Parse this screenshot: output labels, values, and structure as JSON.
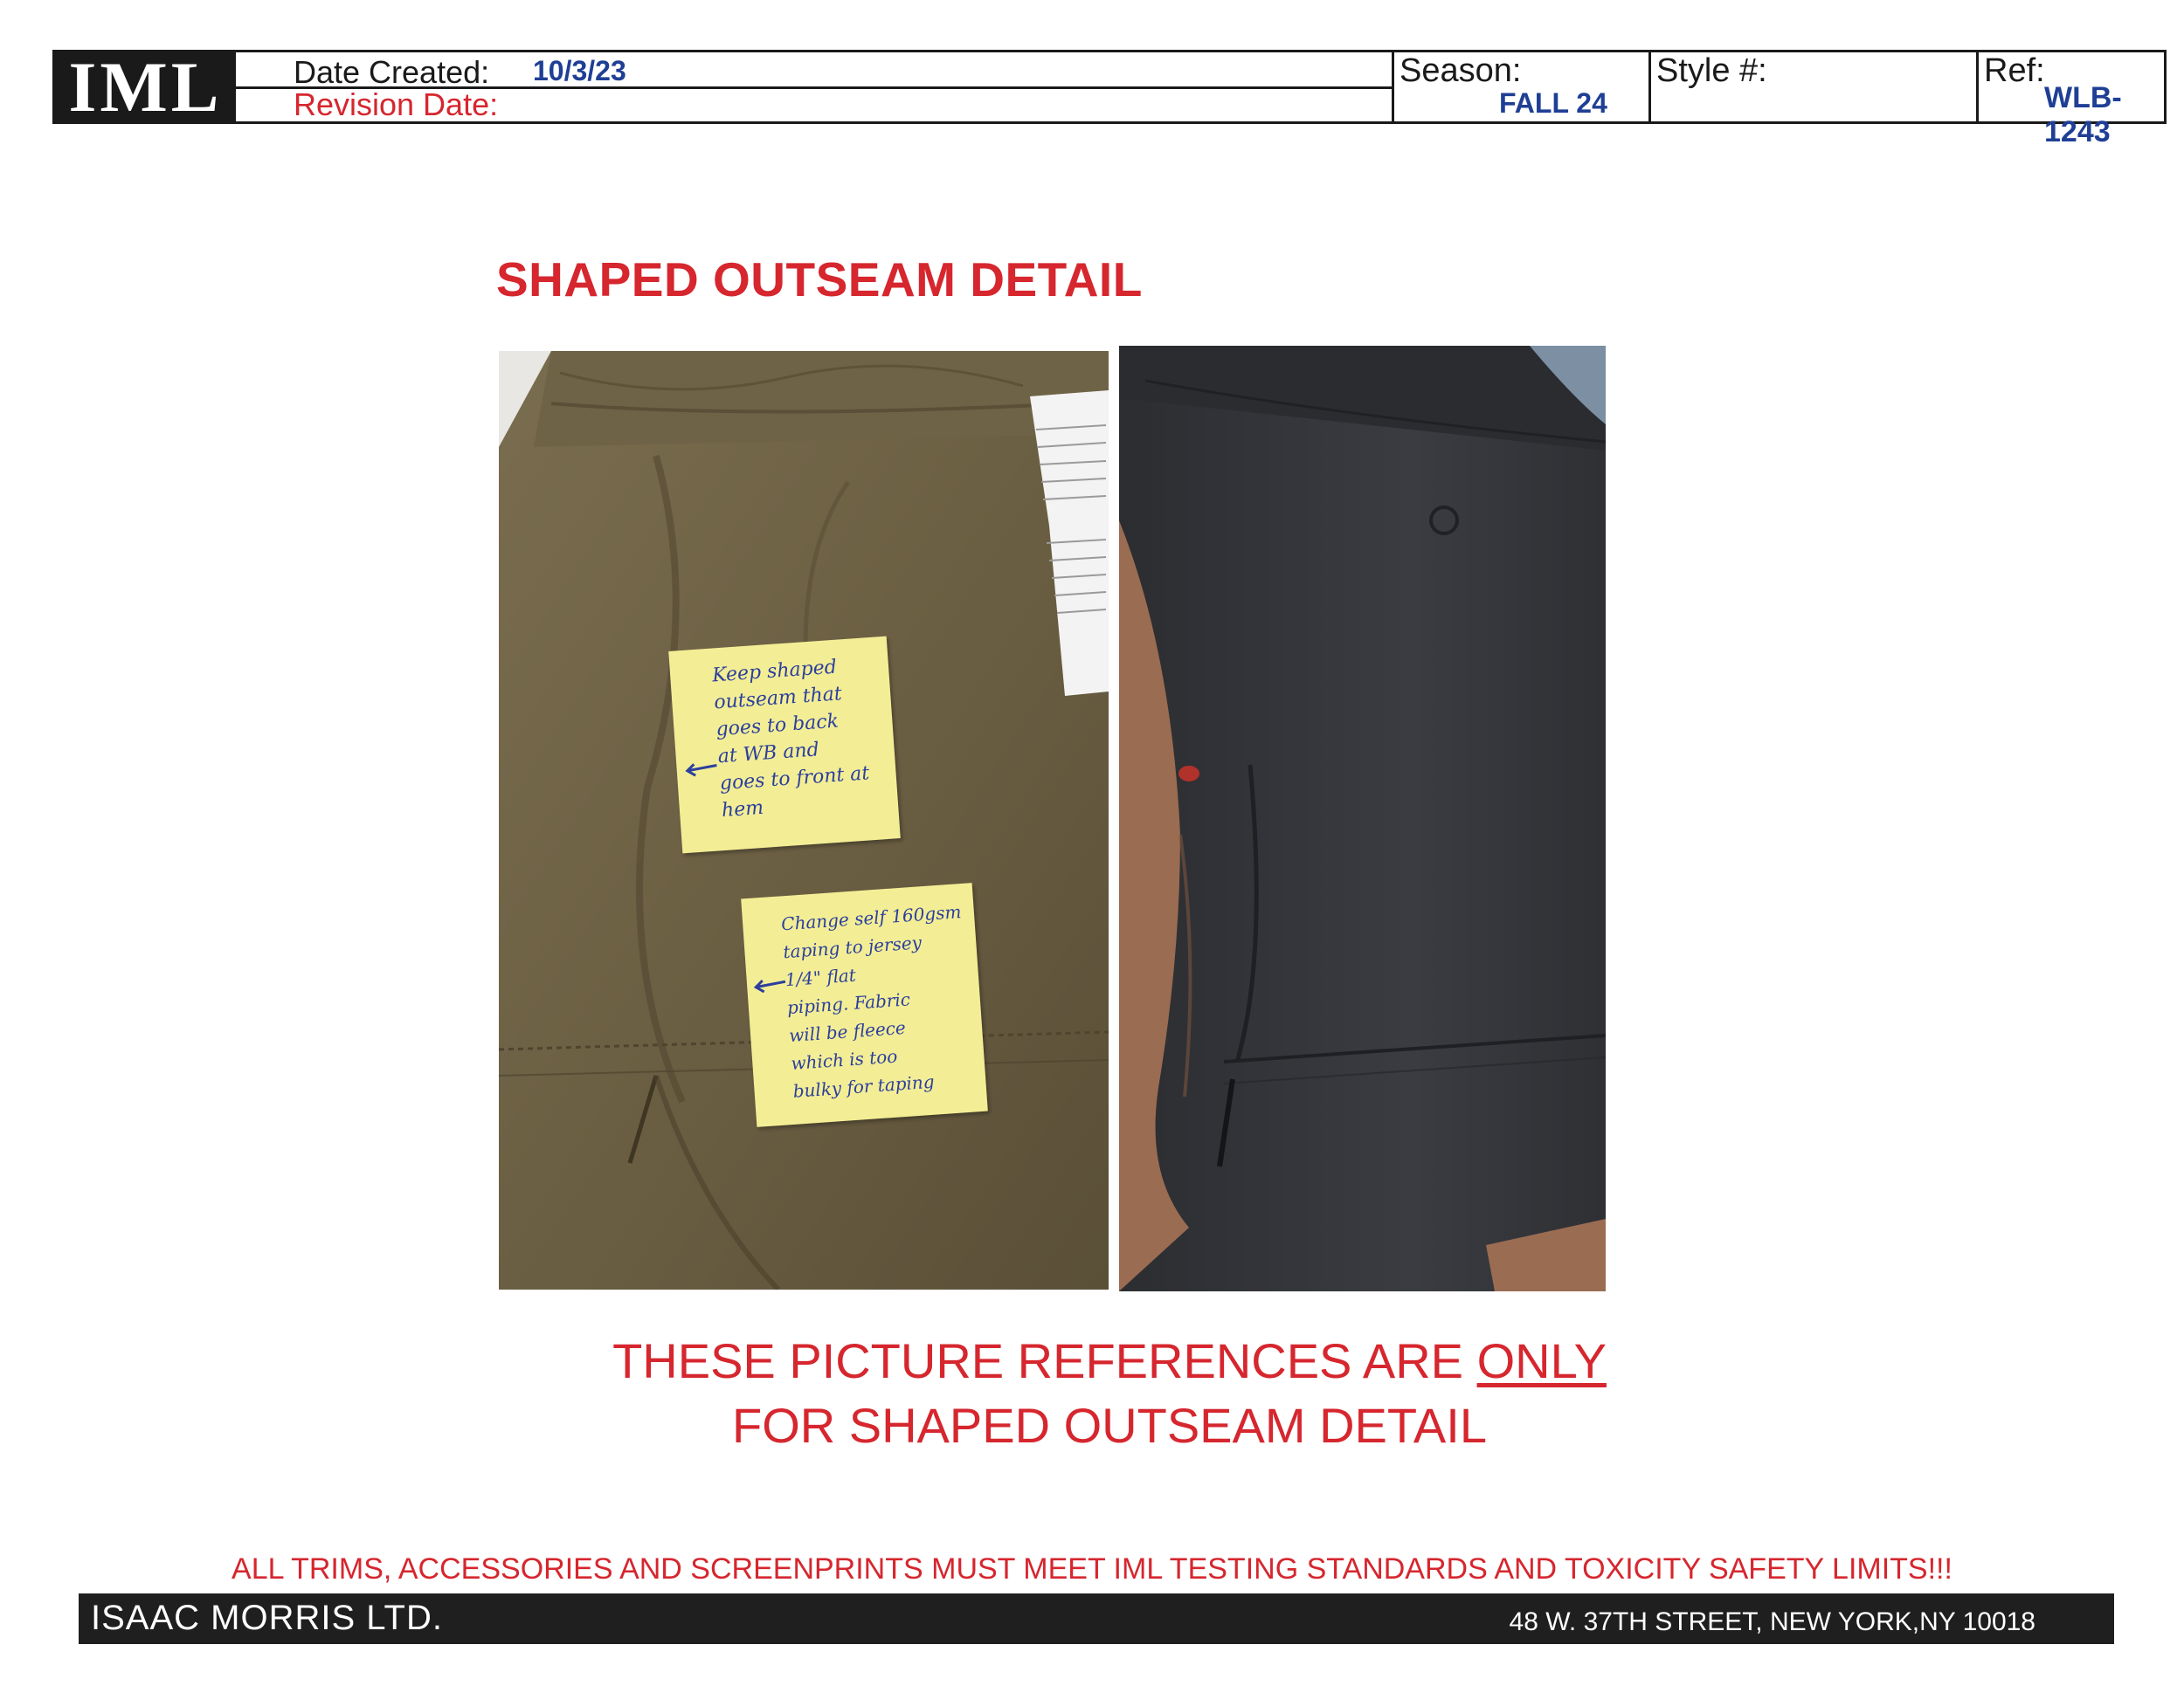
{
  "header": {
    "logo": "IML",
    "date_created_label": "Date Created:",
    "date_created_value": "10/3/23",
    "revision_date_label": "Revision Date:",
    "season_label": "Season:",
    "season_value": "FALL 24",
    "style_label": "Style #:",
    "ref_label": "Ref:",
    "ref_value": "WLB-1243"
  },
  "section_title": "SHAPED OUTSEAM DETAIL",
  "sticky_notes": {
    "note1": [
      "Keep shaped",
      "outseam that",
      "goes to back",
      "at WB and",
      "goes to front at",
      "hem"
    ],
    "note2": [
      "Change self 160gsm",
      "taping to jersey",
      "1/4\" flat",
      "piping. Fabric",
      "will be fleece",
      "which is too",
      "bulky for taping"
    ]
  },
  "reference_note": {
    "line1_prefix": "THESE PICTURE REFERENCES ARE ",
    "line1_emphasis": "ONLY",
    "line2": "FOR SHAPED OUTSEAM DETAIL"
  },
  "footer": {
    "compliance": "ALL TRIMS, ACCESSORIES AND SCREENPRINTS MUST MEET IML TESTING STANDARDS AND TOXICITY SAFETY LIMITS!!!",
    "company": "ISAAC MORRIS LTD.",
    "address": "48 W. 37TH STREET, NEW YORK,NY 10018"
  },
  "colors": {
    "accent_red": "#d6262e",
    "value_blue": "#1f3f95",
    "ink_blue": "#2c3f9e",
    "sticky_yellow": "#f3ee95",
    "olive_fabric": "#6b5f43",
    "charcoal_fabric": "#34363a"
  }
}
